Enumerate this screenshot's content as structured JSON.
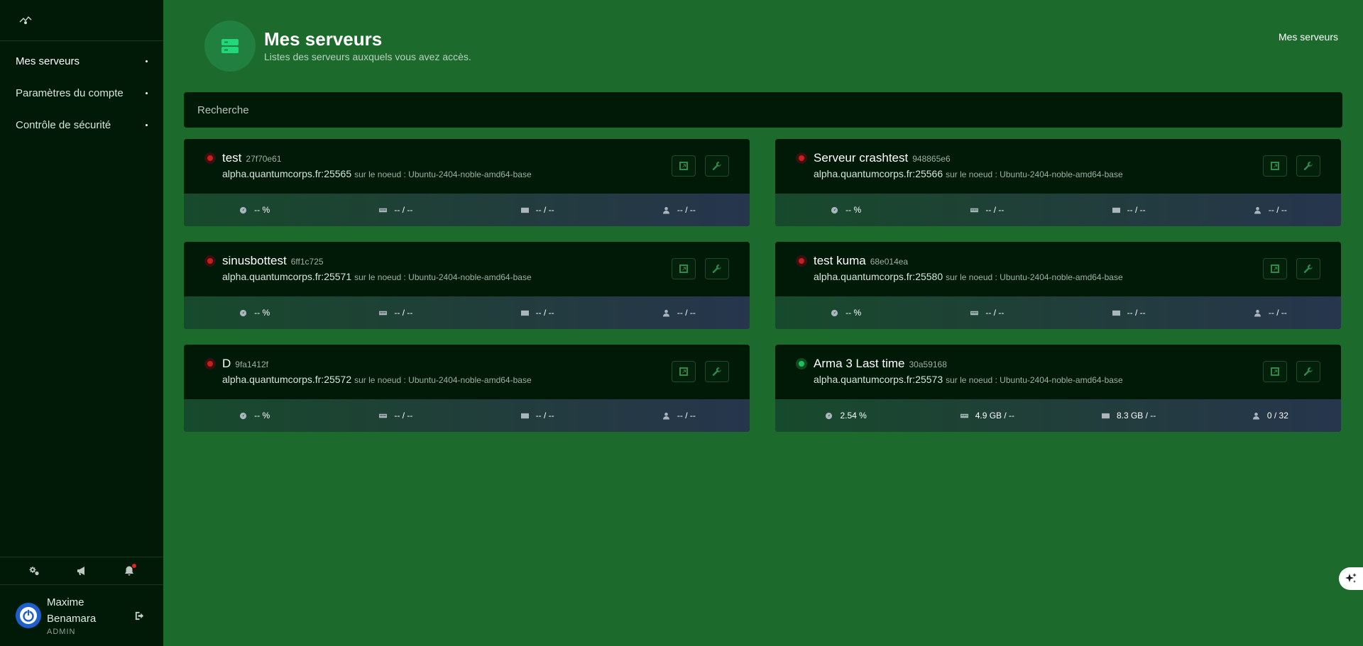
{
  "sidebar": {
    "logo": "quantumcorps-logo",
    "items": [
      {
        "label": "Mes serveurs",
        "active": true
      },
      {
        "label": "Paramètres du compte",
        "active": false
      },
      {
        "label": "Contrôle de sécurité",
        "active": false
      }
    ],
    "tools": [
      "settings-icon",
      "megaphone-icon",
      "bell-icon"
    ],
    "user": {
      "first_name": "Maxime",
      "last_name": "Benamara",
      "role": "ADMIN"
    }
  },
  "header": {
    "title": "Mes serveurs",
    "subtitle": "Listes des serveurs auxquels vous avez accès.",
    "breadcrumb": "Mes serveurs"
  },
  "search": {
    "placeholder": "Recherche"
  },
  "servers": [
    {
      "name": "test",
      "id": "27f70e61",
      "address": "alpha.quantumcorps.fr:25565",
      "node": "sur le noeud : Ubuntu-2404-noble-amd64-base",
      "status": "offline",
      "cpu": "-- %",
      "memory": "-- / --",
      "disk": "-- / --",
      "players": "-- / --"
    },
    {
      "name": "Serveur crashtest",
      "id": "948865e6",
      "address": "alpha.quantumcorps.fr:25566",
      "node": "sur le noeud : Ubuntu-2404-noble-amd64-base",
      "status": "offline",
      "cpu": "-- %",
      "memory": "-- / --",
      "disk": "-- / --",
      "players": "-- / --"
    },
    {
      "name": "sinusbottest",
      "id": "6ff1c725",
      "address": "alpha.quantumcorps.fr:25571",
      "node": "sur le noeud : Ubuntu-2404-noble-amd64-base",
      "status": "offline",
      "cpu": "-- %",
      "memory": "-- / --",
      "disk": "-- / --",
      "players": "-- / --"
    },
    {
      "name": "test kuma",
      "id": "68e014ea",
      "address": "alpha.quantumcorps.fr:25580",
      "node": "sur le noeud : Ubuntu-2404-noble-amd64-base",
      "status": "offline",
      "cpu": "-- %",
      "memory": "-- / --",
      "disk": "-- / --",
      "players": "-- / --"
    },
    {
      "name": "D",
      "id": "9fa1412f",
      "address": "alpha.quantumcorps.fr:25572",
      "node": "sur le noeud : Ubuntu-2404-noble-amd64-base",
      "status": "offline",
      "cpu": "-- %",
      "memory": "-- / --",
      "disk": "-- / --",
      "players": "-- / --"
    },
    {
      "name": "Arma 3 Last time",
      "id": "30a59168",
      "address": "alpha.quantumcorps.fr:25573",
      "node": "sur le noeud : Ubuntu-2404-noble-amd64-base",
      "status": "online",
      "cpu": "2.54 %",
      "memory": "4.9 GB / --",
      "disk": "8.3 GB / --",
      "players": "0 / 32"
    }
  ],
  "colors": {
    "background": "#1c6a2c",
    "sidebar": "#011a08",
    "card": "#001a07",
    "offline": "#c81e1e",
    "online": "#1fc15a",
    "avatar": "#1f5fcc"
  }
}
